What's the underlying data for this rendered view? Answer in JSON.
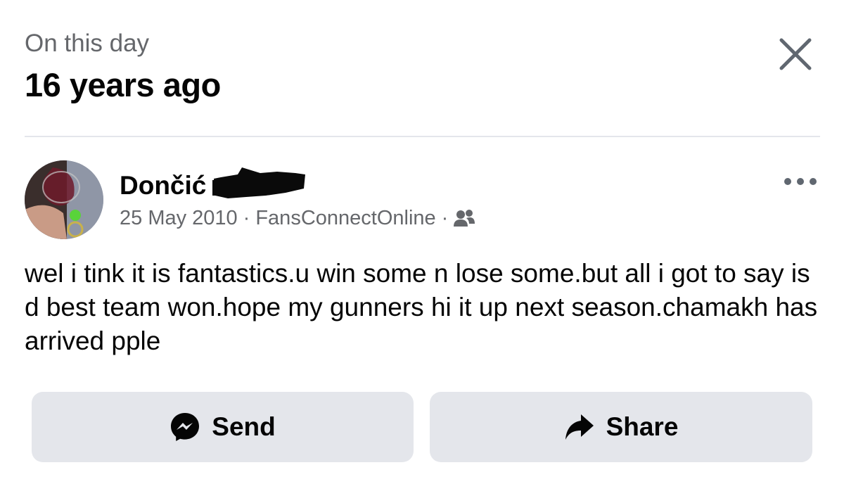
{
  "header": {
    "subtitle": "On this day",
    "title": "16 years ago"
  },
  "post": {
    "author": "Dončić",
    "date": "25 May 2010",
    "separator": "·",
    "source": "FansConnectOnline",
    "audience_icon": "friends-icon",
    "text": "wel i tink it is fantastics.u win some n lose some.but all i got to say is d best team won.hope my gunners hi it up next season.chamakh has arrived pple"
  },
  "actions": {
    "send_label": "Send",
    "share_label": "Share"
  },
  "colors": {
    "secondary_text": "#65676b",
    "button_bg": "#e4e6eb",
    "primary_text": "#050505"
  }
}
